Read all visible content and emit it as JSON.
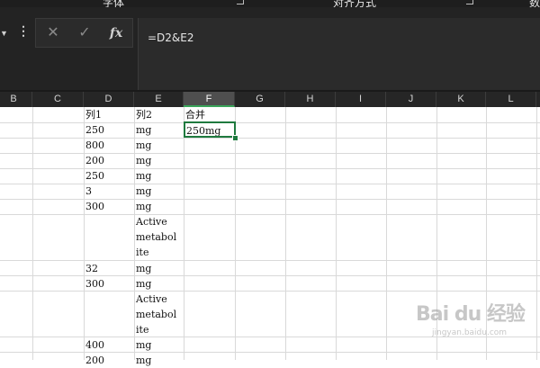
{
  "ribbon": {
    "groups": [
      {
        "label": "字体"
      },
      {
        "label": "对齐方式"
      },
      {
        "label": "数"
      }
    ]
  },
  "formula_bar": {
    "formula": "=D2&E2",
    "cancel_symbol": "✕",
    "enter_symbol": "✓",
    "fx_label": "fx",
    "menu_symbol": "⋮"
  },
  "columns": [
    "B",
    "C",
    "D",
    "E",
    "F",
    "G",
    "H",
    "I",
    "J",
    "K",
    "L"
  ],
  "selected_column": "F",
  "headers": {
    "d": "列1",
    "e": "列2",
    "f": "合并"
  },
  "rows": [
    {
      "d": "250",
      "e": "mg",
      "f": "250mg"
    },
    {
      "d": "800",
      "e": "mg",
      "f": ""
    },
    {
      "d": "200",
      "e": "mg",
      "f": ""
    },
    {
      "d": "250",
      "e": "mg",
      "f": ""
    },
    {
      "d": "3",
      "e": "mg",
      "f": ""
    },
    {
      "d": "300",
      "e": "mg",
      "f": ""
    },
    {
      "d": "",
      "e": "Active\nmetabol\nite",
      "f": ""
    },
    {
      "d": "32",
      "e": "mg",
      "f": ""
    },
    {
      "d": "300",
      "e": "mg",
      "f": ""
    },
    {
      "d": "",
      "e": "Active\nmetabol\nite",
      "f": ""
    },
    {
      "d": "400",
      "e": "mg",
      "f": ""
    },
    {
      "d": "200",
      "e": "mg",
      "f": ""
    }
  ],
  "watermark": {
    "brand": "Bai du 经验",
    "url": "jingyan.baidu.com"
  },
  "colors": {
    "accent": "#1f7a3f",
    "dark_bg": "#232323"
  }
}
